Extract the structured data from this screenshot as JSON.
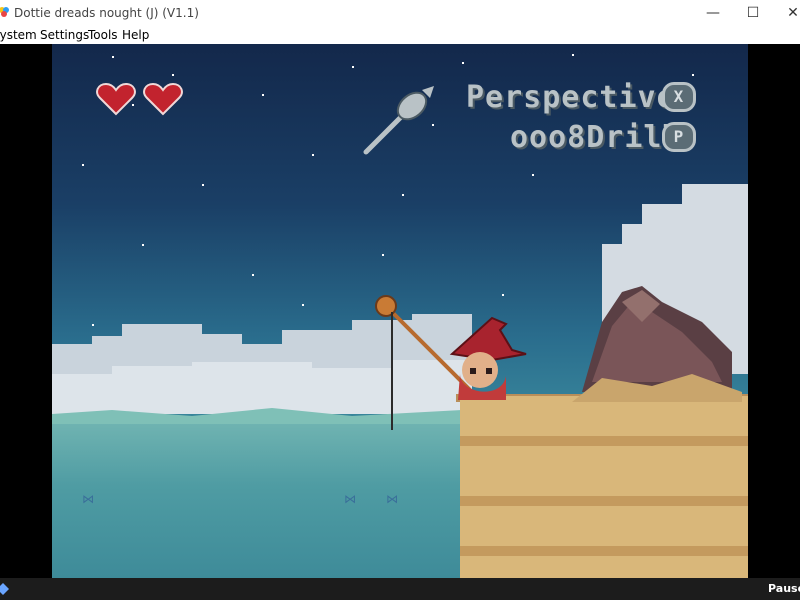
{
  "window": {
    "title": "Dottie dreads nought (J) (V1.1)",
    "controls": {
      "minimize": "—",
      "maximize": "☐",
      "close": "✕"
    }
  },
  "menu": {
    "items": [
      "System",
      "Settings",
      "Tools",
      "Help"
    ]
  },
  "game": {
    "lives": 2,
    "hud": {
      "line1": "Perspective",
      "line2": "ooo8Drill",
      "button_x": "X",
      "button_p": "P"
    }
  },
  "status": {
    "text": "Paused"
  },
  "colors": {
    "heart": "#c2232e",
    "hud_text": "#b9c2c6",
    "sky_top": "#13284b",
    "sea": "#4f9ca3",
    "cliff": "#d9b77a"
  }
}
